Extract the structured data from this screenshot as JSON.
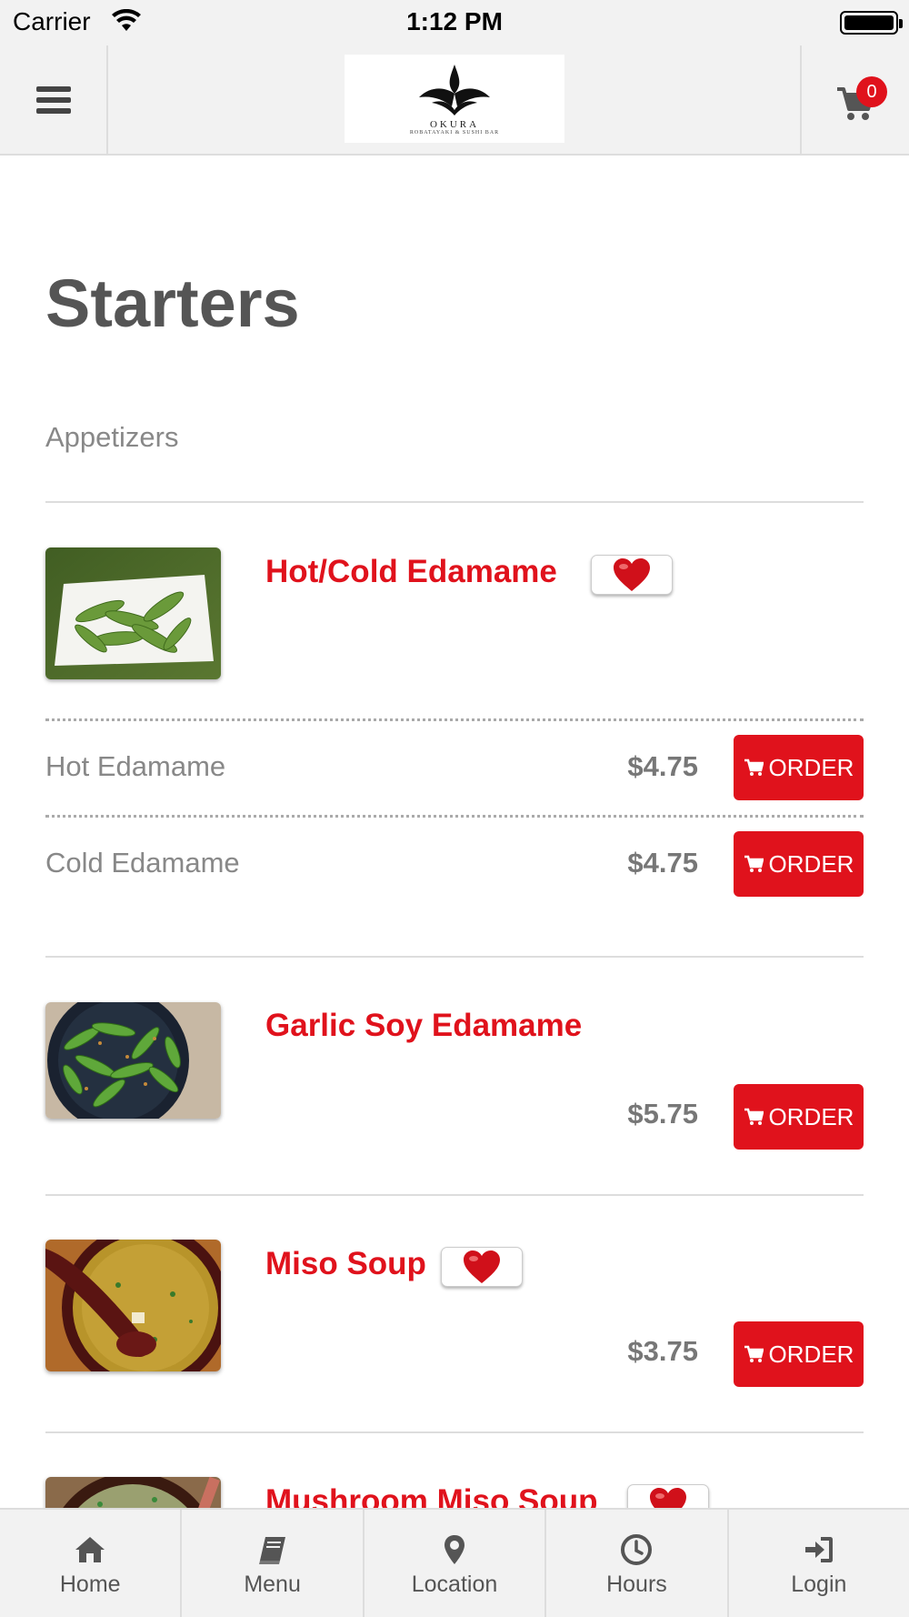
{
  "status_bar": {
    "carrier": "Carrier",
    "time": "1:12 PM"
  },
  "header": {
    "logo_text": "OKURA",
    "logo_subtext": "ROBATAYAKI & SUSHI BAR",
    "cart_count": "0"
  },
  "page": {
    "title": "Starters",
    "subtitle": "Appetizers"
  },
  "items": [
    {
      "name": "Hot/Cold Edamame",
      "image": "edamame-plate",
      "favorite": true,
      "variants": [
        {
          "name": "Hot Edamame",
          "price": "$4.75",
          "order_label": "ORDER"
        },
        {
          "name": "Cold Edamame",
          "price": "$4.75",
          "order_label": "ORDER"
        }
      ]
    },
    {
      "name": "Garlic Soy Edamame",
      "image": "garlic-edamame-bowl",
      "favorite": false,
      "price": "$5.75",
      "order_label": "ORDER"
    },
    {
      "name": "Miso Soup",
      "image": "miso-soup-bowl",
      "favorite": true,
      "price": "$3.75",
      "order_label": "ORDER"
    },
    {
      "name": "Mushroom Miso Soup",
      "image": "mushroom-miso-bowl",
      "favorite": true
    }
  ],
  "tab_bar": [
    {
      "label": "Home",
      "icon": "home-icon"
    },
    {
      "label": "Menu",
      "icon": "book-icon"
    },
    {
      "label": "Location",
      "icon": "map-pin-icon"
    },
    {
      "label": "Hours",
      "icon": "clock-icon"
    },
    {
      "label": "Login",
      "icon": "login-icon"
    }
  ],
  "colors": {
    "accent": "#e0121c",
    "bar_bg": "#f2f2f2",
    "text": "#555555"
  }
}
